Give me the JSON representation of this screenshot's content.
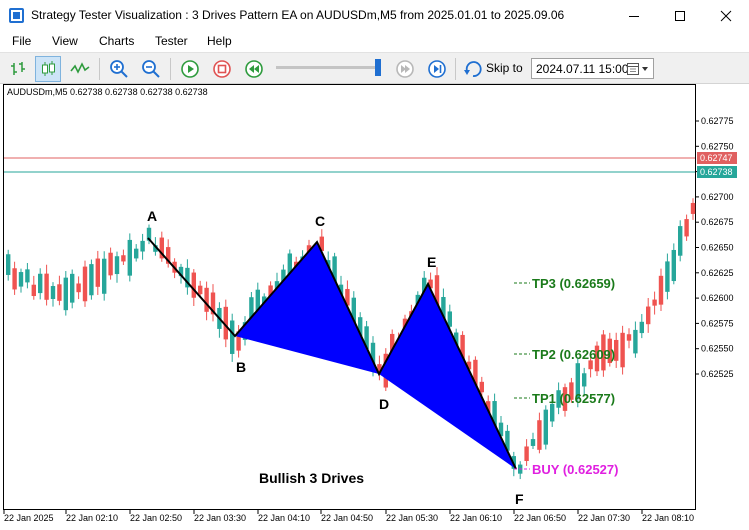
{
  "window": {
    "title": "Strategy Tester Visualization : 3 Drives Pattern EA on AUDUSDm,M5 from 2025.01.01 to 2025.09.06"
  },
  "menu": [
    "File",
    "View",
    "Charts",
    "Tester",
    "Help"
  ],
  "toolbar": {
    "skip_label": "Skip to",
    "skip_date": "2024.07.11 15:00",
    "buttons": [
      "bar-chart",
      "candlesticks",
      "line-chart",
      "zoom-in",
      "zoom-out",
      "play",
      "stop",
      "rewind",
      "slider",
      "step-forward",
      "skip-forward",
      "skip-to"
    ],
    "speed_level": 0.97
  },
  "chart": {
    "symbol_info": "AUDUSDm,M5  0.62738 0.62738 0.62738 0.62738",
    "price_ticks": [
      "0.62775",
      "0.62750",
      "0.62725",
      "0.62700",
      "0.62675",
      "0.62650",
      "0.62625",
      "0.62600",
      "0.62575",
      "0.62550",
      "0.62525"
    ],
    "time_ticks": [
      "22 Jan 2025",
      "22 Jan 02:10",
      "22 Jan 02:50",
      "22 Jan 03:30",
      "22 Jan 04:10",
      "22 Jan 04:50",
      "22 Jan 05:30",
      "22 Jan 06:10",
      "22 Jan 06:50",
      "22 Jan 07:30",
      "22 Jan 08:10"
    ],
    "ask_label": "0.62747",
    "bid_label": "0.62738",
    "points": {
      "A": "A",
      "B": "B",
      "C": "C",
      "D": "D",
      "E": "E",
      "F": "F"
    },
    "tp3": "TP3 (0.62659)",
    "tp2": "TP2 (0.62609)",
    "tp1": "TP1 (0.62577)",
    "buy": "BUY (0.62527)",
    "pattern": "Bullish 3 Drives",
    "colors": {
      "bull": "#26a69a",
      "bear": "#ef5350",
      "fill": "#0000ff",
      "tp": "#1a7a1a",
      "buy": "#e020e0",
      "ask_line": "#e06060",
      "bid_line": "#26a69a"
    }
  }
}
